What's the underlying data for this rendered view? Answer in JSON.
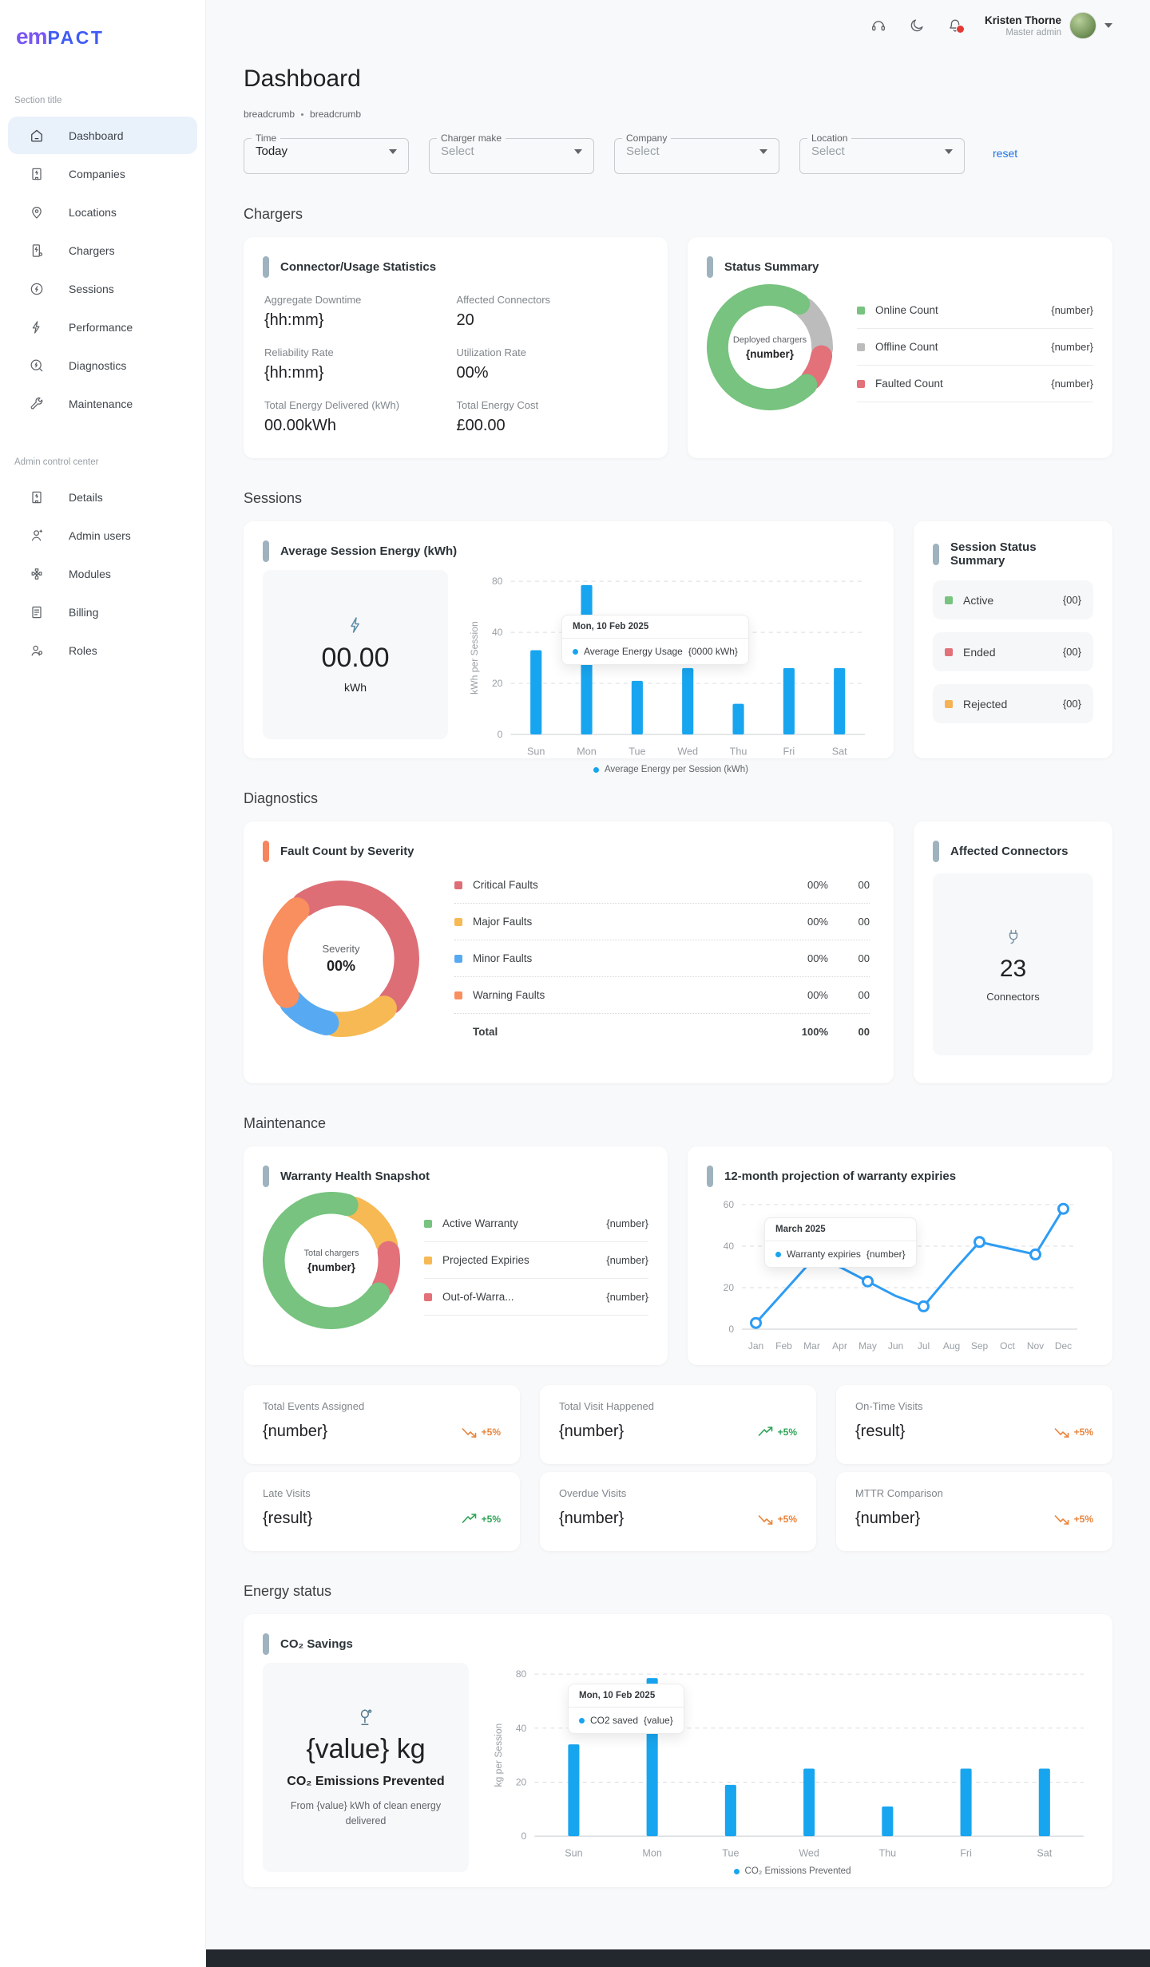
{
  "brand": {
    "logo_em": "em",
    "logo_pact": "PACT"
  },
  "header": {
    "user_name": "Kristen Thorne",
    "user_role": "Master admin"
  },
  "sidebar": {
    "section_title": "Section title",
    "items": [
      {
        "label": "Dashboard"
      },
      {
        "label": "Companies"
      },
      {
        "label": "Locations"
      },
      {
        "label": "Chargers"
      },
      {
        "label": "Sessions"
      },
      {
        "label": "Performance"
      },
      {
        "label": "Diagnostics"
      },
      {
        "label": "Maintenance"
      }
    ],
    "admin_section_title": "Admin control center",
    "admin_items": [
      {
        "label": "Details"
      },
      {
        "label": "Admin users"
      },
      {
        "label": "Modules"
      },
      {
        "label": "Billing"
      },
      {
        "label": "Roles"
      }
    ]
  },
  "page": {
    "title": "Dashboard",
    "breadcrumb1": "breadcrumb",
    "breadcrumb2": "breadcrumb"
  },
  "filters": {
    "time": {
      "label": "Time",
      "value": "Today"
    },
    "charger_make": {
      "label": "Charger make",
      "value": "Select"
    },
    "company": {
      "label": "Company",
      "value": "Select"
    },
    "location": {
      "label": "Location",
      "value": "Select"
    },
    "reset_label": "reset"
  },
  "sections": {
    "chargers": "Chargers",
    "sessions": "Sessions",
    "diagnostics": "Diagnostics",
    "maintenance": "Maintenance",
    "energy": "Energy status"
  },
  "connector_stats": {
    "title": "Connector/Usage Statistics",
    "stats": [
      {
        "label": "Aggregate Downtime",
        "value": "{hh:mm}"
      },
      {
        "label": "Affected Connectors",
        "value": "20"
      },
      {
        "label": "Reliability Rate",
        "value": "{hh:mm}"
      },
      {
        "label": "Utilization Rate",
        "value": "00%"
      },
      {
        "label": "Total Energy Delivered (kWh)",
        "value": "00.00kWh"
      },
      {
        "label": "Total Energy Cost",
        "value": "£00.00"
      }
    ]
  },
  "status_summary": {
    "title": "Status Summary",
    "center_label": "Deployed chargers",
    "center_value": "{number}",
    "legend": [
      {
        "label": "Online Count",
        "value": "{number}",
        "color": "#77c37f"
      },
      {
        "label": "Offline Count",
        "value": "{number}",
        "color": "#bcbcbc"
      },
      {
        "label": "Faulted Count",
        "value": "{number}",
        "color": "#e2717a"
      }
    ]
  },
  "session_energy": {
    "title": "Average Session Energy (kWh)",
    "stat_value": "00.00",
    "stat_unit": "kWh",
    "tooltip": {
      "date": "Mon, 10 Feb 2025",
      "label": "Average Energy Usage",
      "value": "{0000 kWh}"
    },
    "legend": "Average Energy per Session (kWh)"
  },
  "session_status": {
    "title": "Session Status Summary",
    "rows": [
      {
        "label": "Active",
        "value": "{00}",
        "color": "#77c37f"
      },
      {
        "label": "Ended",
        "value": "{00}",
        "color": "#e2717a"
      },
      {
        "label": "Rejected",
        "value": "{00}",
        "color": "#f6b154"
      }
    ]
  },
  "fault_severity": {
    "title": "Fault Count by Severity",
    "center_label": "Severity",
    "center_value": "00%",
    "rows": [
      {
        "label": "Critical Faults",
        "pct": "00%",
        "count": "00",
        "color": "#dd6e76"
      },
      {
        "label": "Major Faults",
        "pct": "00%",
        "count": "00",
        "color": "#f6b954"
      },
      {
        "label": "Minor Faults",
        "pct": "00%",
        "count": "00",
        "color": "#57aaf2"
      },
      {
        "label": "Warning Faults",
        "pct": "00%",
        "count": "00",
        "color": "#f98e5e"
      }
    ],
    "total": {
      "label": "Total",
      "pct": "100%",
      "count": "00"
    }
  },
  "affected_connectors": {
    "title": "Affected Connectors",
    "value": "23",
    "label": "Connectors"
  },
  "warranty": {
    "title": "Warranty Health Snapshot",
    "center_label": "Total chargers",
    "center_value": "{number}",
    "legend": [
      {
        "label": "Active Warranty",
        "value": "{number}",
        "color": "#77c37f"
      },
      {
        "label": "Projected Expiries",
        "value": "{number}",
        "color": "#f6b954"
      },
      {
        "label": "Out-of-Warra...",
        "value": "{number}",
        "color": "#e2717a"
      }
    ]
  },
  "warranty_projection": {
    "title": "12-month projection of warranty expiries",
    "tooltip": {
      "date": "March 2025",
      "label": "Warranty expiries",
      "value": "{number}"
    }
  },
  "stat_cards": [
    {
      "label": "Total Events Assigned",
      "value": "{number}",
      "trend": "down",
      "delta": "+5%"
    },
    {
      "label": "Total Visit Happened",
      "value": "{number}",
      "trend": "up",
      "delta": "+5%"
    },
    {
      "label": "On-Time Visits",
      "value": "{result}",
      "trend": "down",
      "delta": "+5%"
    },
    {
      "label": "Late Visits",
      "value": "{result}",
      "trend": "up",
      "delta": "+5%"
    },
    {
      "label": "Overdue Visits",
      "value": "{number}",
      "trend": "down",
      "delta": "+5%"
    },
    {
      "label": "MTTR Comparison",
      "value": "{number}",
      "trend": "down",
      "delta": "+5%"
    }
  ],
  "co2": {
    "title": "CO₂ Savings",
    "value": "{value} kg",
    "subtitle": "CO₂ Emissions Prevented",
    "note": "From {value} kWh of clean energy delivered",
    "tooltip": {
      "date": "Mon, 10 Feb 2025",
      "label": "CO2 saved",
      "value": "{value}"
    },
    "legend": "CO₂ Emissions Prevented"
  },
  "chart_data": [
    {
      "id": "session_energy",
      "type": "bar",
      "title": "Average Session Energy (kWh)",
      "categories": [
        "Sun",
        "Mon",
        "Tue",
        "Wed",
        "Thu",
        "Fri",
        "Sat"
      ],
      "values": [
        33,
        77,
        21,
        26,
        12,
        26,
        26
      ],
      "yticks": [
        0,
        20,
        40,
        80
      ],
      "ylabel": "kWh per Session",
      "bar_color": "#18a5ef",
      "legend": "Average Energy per Session (kWh)"
    },
    {
      "id": "warranty_projection",
      "type": "line",
      "title": "12-month projection of warranty expiries",
      "categories": [
        "Jan",
        "Feb",
        "Mar",
        "Apr",
        "May",
        "Jun",
        "Jul",
        "Aug",
        "Sep",
        "Oct",
        "Nov",
        "Dec"
      ],
      "values": [
        3,
        18,
        33,
        30,
        23,
        16,
        11,
        27,
        42,
        39,
        36,
        58
      ],
      "marker_indices": [
        0,
        4,
        6,
        8,
        10,
        11
      ],
      "yticks": [
        0,
        20,
        40,
        60
      ],
      "line_color": "#2d9cf4"
    },
    {
      "id": "co2_savings",
      "type": "bar",
      "title": "CO₂ Savings",
      "categories": [
        "Sun",
        "Mon",
        "Tue",
        "Wed",
        "Thu",
        "Fri",
        "Sat"
      ],
      "values": [
        34,
        77,
        19,
        25,
        11,
        25,
        25
      ],
      "yticks": [
        0,
        20,
        40,
        80
      ],
      "ylabel": "kg per Session",
      "bar_color": "#18a5ef",
      "legend": "CO₂ Emissions Prevented"
    },
    {
      "id": "status_donut",
      "type": "donut",
      "start_angle": 38,
      "segments": [
        {
          "label": "Offline Count",
          "value": 16,
          "color": "#bcbcbc"
        },
        {
          "label": "Faulted Count",
          "value": 10,
          "color": "#e2717a"
        },
        {
          "label": "Online Count",
          "value": 74,
          "color": "#77c37f"
        }
      ]
    },
    {
      "id": "fault_donut",
      "type": "donut",
      "start_angle": 322,
      "segments": [
        {
          "label": "Critical Faults",
          "value": 48,
          "color": "#dd6e76"
        },
        {
          "label": "Major Faults",
          "value": 15,
          "color": "#f6b954"
        },
        {
          "label": "Minor Faults",
          "value": 12,
          "color": "#57aaf2"
        },
        {
          "label": "Warning Faults",
          "value": 25,
          "color": "#f98e5e"
        }
      ]
    },
    {
      "id": "warranty_donut",
      "type": "donut",
      "start_angle": 20,
      "segments": [
        {
          "label": "Projected Expiries",
          "value": 16,
          "color": "#f6b954"
        },
        {
          "label": "Out-of-Warranty",
          "value": 12,
          "color": "#e2717a"
        },
        {
          "label": "Active Warranty",
          "value": 72,
          "color": "#77c37f"
        }
      ]
    }
  ]
}
